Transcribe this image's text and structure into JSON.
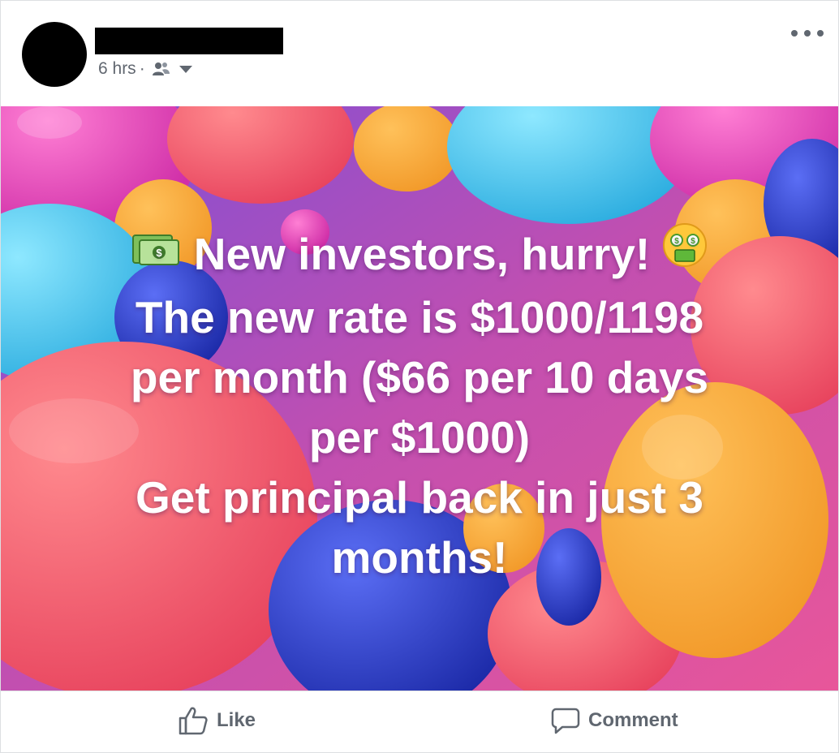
{
  "post": {
    "timestamp": "6 hrs",
    "separator": "·",
    "audience_icon": "friends-icon",
    "menu_icon": "more-options-icon"
  },
  "image": {
    "background_colors": [
      "#e64a8c",
      "#f5a623",
      "#3ec6e8",
      "#2a3ec4",
      "#f2566b",
      "#8a4fd0"
    ],
    "text_lines": [
      "New investors, hurry!",
      "The new rate is $1000/1198",
      "per month ($66 per 10 days",
      "per $1000)",
      "Get principal back in just 3",
      "months!"
    ],
    "emoji_left": "money-icon",
    "emoji_right": "money-mouth-face-icon"
  },
  "actions": {
    "like_label": "Like",
    "comment_label": "Comment"
  }
}
